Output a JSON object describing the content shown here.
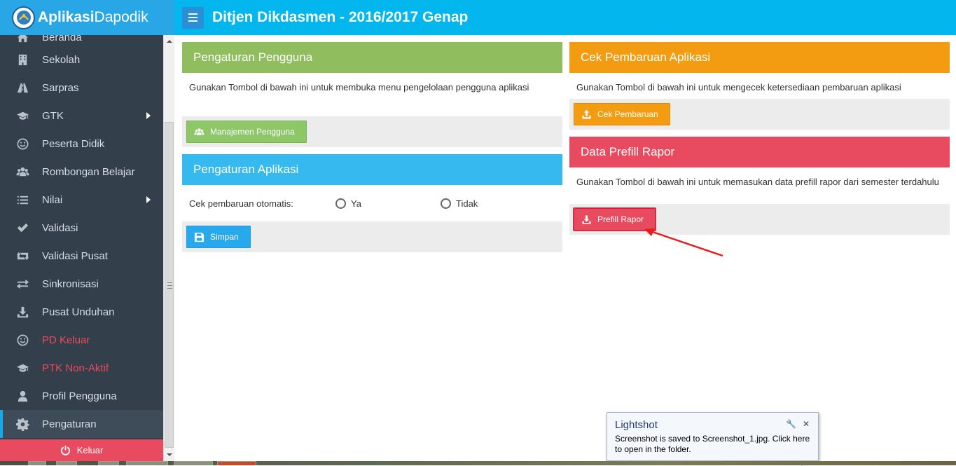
{
  "brand": {
    "bold": "Aplikasi",
    "rest": "Dapodik"
  },
  "topbar": {
    "title": "Ditjen Dikdasmen - 2016/2017 Genap"
  },
  "sidebar": {
    "partial_item": "Beranda",
    "items": [
      {
        "label": "Sekolah",
        "icon": "building-icon"
      },
      {
        "label": "Sarpras",
        "icon": "road-icon"
      },
      {
        "label": "GTK",
        "icon": "graduation-cap-icon",
        "submenu": true
      },
      {
        "label": "Peserta Didik",
        "icon": "smile-icon"
      },
      {
        "label": "Rombongan Belajar",
        "icon": "users-icon"
      },
      {
        "label": "Nilai",
        "icon": "list-icon",
        "submenu": true
      },
      {
        "label": "Validasi",
        "icon": "check-icon"
      },
      {
        "label": "Validasi Pusat",
        "icon": "retweet-icon"
      },
      {
        "label": "Sinkronisasi",
        "icon": "exchange-icon"
      },
      {
        "label": "Pusat Unduhan",
        "icon": "download-icon"
      },
      {
        "label": "PD Keluar",
        "icon": "smile-icon",
        "color": "#e84a5f"
      },
      {
        "label": "PTK Non-Aktif",
        "icon": "graduation-cap-icon",
        "color": "#e84a5f"
      },
      {
        "label": "Profil Pengguna",
        "icon": "user-icon"
      },
      {
        "label": "Pengaturan",
        "icon": "gear-icon",
        "active": true
      }
    ],
    "logout_label": "Keluar"
  },
  "panels": {
    "pengguna": {
      "title": "Pengaturan Pengguna",
      "desc": "Gunakan Tombol di bawah ini untuk membuka menu pengelolaan pengguna aplikasi",
      "button": "Manajemen Pengguna"
    },
    "aplikasi": {
      "title": "Pengaturan Aplikasi",
      "label": "Cek pembaruan otomatis:",
      "option_yes": "Ya",
      "option_no": "Tidak",
      "button": "Simpan"
    },
    "pembaruan": {
      "title": "Cek Pembaruan Aplikasi",
      "desc": "Gunakan Tombol di bawah ini untuk mengecek ketersediaan pembaruan aplikasi",
      "button": "Cek Pembaruan"
    },
    "prefill": {
      "title": "Data Prefill Rapor",
      "desc": "Gunakan Tombol di bawah ini untuk memasukan data prefill rapor dari semester terdahulu",
      "button": "Prefill Rapor"
    }
  },
  "notification": {
    "title": "Lightshot",
    "message": "Screenshot is saved to Screenshot_1.jpg. Click here to open in the folder."
  },
  "colors": {
    "header_blue": "#03b6ed",
    "sidebar_bg": "#33404c",
    "green": "#90bd5e",
    "blue": "#36b9ef",
    "orange": "#f39c12",
    "red": "#e84a5f"
  }
}
